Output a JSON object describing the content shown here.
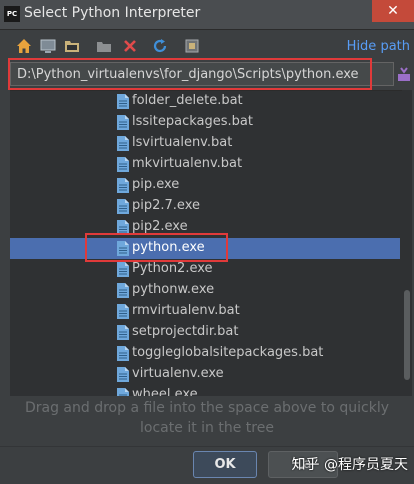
{
  "window": {
    "app_icon_text": "PC",
    "title": "Select Python Interpreter",
    "close_icon": "close-icon"
  },
  "toolbar": {
    "icons": [
      "home-icon",
      "desktop-icon",
      "project-folder-icon",
      "new-folder-icon",
      "delete-icon",
      "refresh-icon",
      "show-hidden-icon"
    ],
    "hide_path_label": "Hide path"
  },
  "path": {
    "value": "D:\\Python_virtualenvs\\for_django\\Scripts\\python.exe",
    "action_icon": "path-history-icon"
  },
  "tree": {
    "items": [
      {
        "name": "folder_delete.bat",
        "selected": false
      },
      {
        "name": "lssitepackages.bat",
        "selected": false
      },
      {
        "name": "lsvirtualenv.bat",
        "selected": false
      },
      {
        "name": "mkvirtualenv.bat",
        "selected": false
      },
      {
        "name": "pip.exe",
        "selected": false
      },
      {
        "name": "pip2.7.exe",
        "selected": false
      },
      {
        "name": "pip2.exe",
        "selected": false
      },
      {
        "name": "python.exe",
        "selected": true
      },
      {
        "name": "Python2.exe",
        "selected": false
      },
      {
        "name": "pythonw.exe",
        "selected": false
      },
      {
        "name": "rmvirtualenv.bat",
        "selected": false
      },
      {
        "name": "setprojectdir.bat",
        "selected": false
      },
      {
        "name": "toggleglobalsitepackages.bat",
        "selected": false
      },
      {
        "name": "virtualenv.exe",
        "selected": false
      },
      {
        "name": "wheel.exe",
        "selected": false
      }
    ]
  },
  "hint": {
    "line1": "Drag and drop a file into the space above to quickly",
    "line2": "locate it in the tree"
  },
  "buttons": {
    "ok_label": "OK",
    "cancel_label": "Ca"
  },
  "watermark": "知乎 @程序员夏天",
  "colors": {
    "selection": "#4b6eaf",
    "highlight_box": "#e03a3a",
    "link": "#589df6"
  }
}
